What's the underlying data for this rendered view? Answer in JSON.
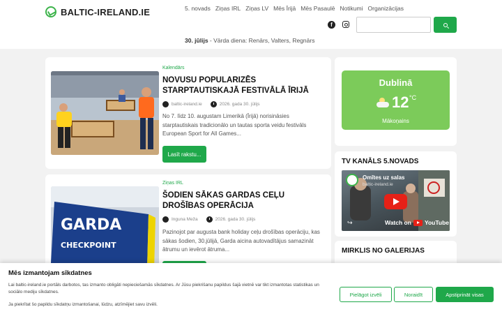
{
  "header": {
    "logo_text": "BALTIC-IRELAND.IE",
    "nav": [
      "5. novads",
      "Ziņas IRL",
      "Ziņas LV",
      "Mēs Īrijā",
      "Mēs Pasaulē",
      "Notikumi",
      "Organizācijas"
    ],
    "social": {
      "facebook": "f"
    },
    "search": {
      "value": "",
      "placeholder": ""
    },
    "date": "30. jūlijs",
    "name_day": " - Vārda diena: Renārs, Valters, Regnārs"
  },
  "articles": [
    {
      "category": "Kalendārs",
      "title": "NOVUSU POPULARIZĒS STARPTAUTISKAJĀ FESTIVĀLĀ ĪRIJĀ",
      "author": "baltic-ireland.ie",
      "date": "2026. gada 30. jūlijs",
      "excerpt": "No 7. līdz 10. augustam Limerikā (Īrijā) norisināsies starptautiskais tradicionālo un tautas sporta veidu festivāls European Sport for All Games...",
      "read_more": "Lasīt rakstu..."
    },
    {
      "category": "Ziņas IRL",
      "title": "ŠODIEN SĀKAS GARDAS CEĻU DROŠĪBAS OPERĀCIJA",
      "author": "Inguna Meža",
      "date": "2026. gada 30. jūlijs",
      "excerpt": "Pazinojot par augusta bank holiday ceļu drošības operāciju, kas sākas šodien, 30.jūlijā, Garda aicina autovadītājus samazināt ātrumu un ievērot ātruma...",
      "sign_top": "GARDA",
      "sign_bottom": "CHECKPOINT"
    }
  ],
  "weather": {
    "city": "Dublinā",
    "temp": "12",
    "unit": "°C",
    "condition": "Mākoņains"
  },
  "tv": {
    "title": "TV KANĀLS 5.NOVADS",
    "video_title": "Omītes uz salas",
    "video_channel": "baltic-ireland.ie",
    "watch_label": "Watch on",
    "youtube_label": "YouTube",
    "share_icon": "share-icon"
  },
  "gallery": {
    "title": "MIRKLIS NO GALERIJAS"
  },
  "cookie": {
    "title": "Mēs izmantojam sīkdatnes",
    "text": "Lai baltic-ireland.ie portāls darbotos, tas izmanto obligāti nepieciešamās sīkdatnes. Ar Jūsu piekrišanu papildus šajā vietnē var tikt izmantotas statistikas un sociālo mediju sīkdatnes.",
    "text2": "Ja piekrītat šo papildu sīkdatņu izmantošanai, lūdzu, atzīmējiet savu izvēli.",
    "btn_customize": "Pielāgot izvēli",
    "btn_reject": "Noraidīt",
    "btn_accept": "Apstiprināt visas"
  },
  "colors": {
    "accent": "#1fa84a",
    "weather_bg": "#7ccb5a",
    "youtube_red": "#e62117"
  }
}
